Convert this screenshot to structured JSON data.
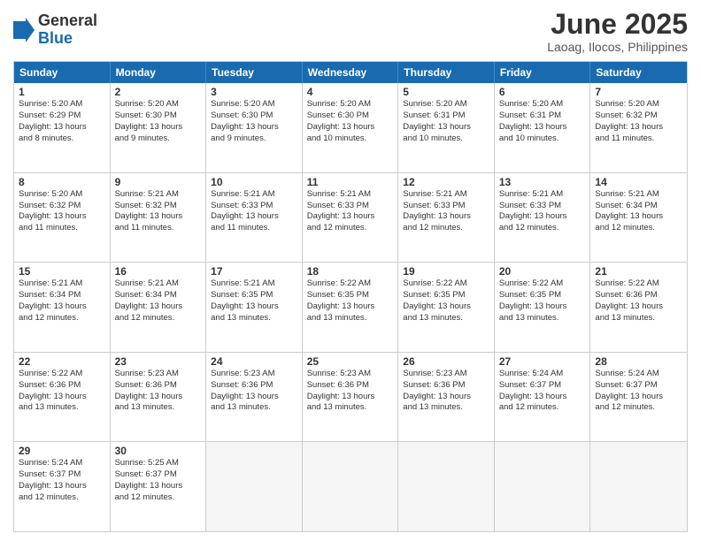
{
  "logo": {
    "general": "General",
    "blue": "Blue"
  },
  "title": "June 2025",
  "subtitle": "Laoag, Ilocos, Philippines",
  "headers": [
    "Sunday",
    "Monday",
    "Tuesday",
    "Wednesday",
    "Thursday",
    "Friday",
    "Saturday"
  ],
  "rows": [
    [
      {
        "day": "",
        "lines": [],
        "empty": true
      },
      {
        "day": "",
        "lines": [],
        "empty": true
      },
      {
        "day": "",
        "lines": [],
        "empty": true
      },
      {
        "day": "",
        "lines": [],
        "empty": true
      },
      {
        "day": "",
        "lines": [],
        "empty": true
      },
      {
        "day": "",
        "lines": [],
        "empty": true
      },
      {
        "day": "",
        "lines": [],
        "empty": true
      }
    ],
    [
      {
        "day": "1",
        "lines": [
          "Sunrise: 5:20 AM",
          "Sunset: 6:29 PM",
          "Daylight: 13 hours",
          "and 8 minutes."
        ],
        "empty": false
      },
      {
        "day": "2",
        "lines": [
          "Sunrise: 5:20 AM",
          "Sunset: 6:30 PM",
          "Daylight: 13 hours",
          "and 9 minutes."
        ],
        "empty": false
      },
      {
        "day": "3",
        "lines": [
          "Sunrise: 5:20 AM",
          "Sunset: 6:30 PM",
          "Daylight: 13 hours",
          "and 9 minutes."
        ],
        "empty": false
      },
      {
        "day": "4",
        "lines": [
          "Sunrise: 5:20 AM",
          "Sunset: 6:30 PM",
          "Daylight: 13 hours",
          "and 10 minutes."
        ],
        "empty": false
      },
      {
        "day": "5",
        "lines": [
          "Sunrise: 5:20 AM",
          "Sunset: 6:31 PM",
          "Daylight: 13 hours",
          "and 10 minutes."
        ],
        "empty": false
      },
      {
        "day": "6",
        "lines": [
          "Sunrise: 5:20 AM",
          "Sunset: 6:31 PM",
          "Daylight: 13 hours",
          "and 10 minutes."
        ],
        "empty": false
      },
      {
        "day": "7",
        "lines": [
          "Sunrise: 5:20 AM",
          "Sunset: 6:32 PM",
          "Daylight: 13 hours",
          "and 11 minutes."
        ],
        "empty": false
      }
    ],
    [
      {
        "day": "8",
        "lines": [
          "Sunrise: 5:20 AM",
          "Sunset: 6:32 PM",
          "Daylight: 13 hours",
          "and 11 minutes."
        ],
        "empty": false
      },
      {
        "day": "9",
        "lines": [
          "Sunrise: 5:21 AM",
          "Sunset: 6:32 PM",
          "Daylight: 13 hours",
          "and 11 minutes."
        ],
        "empty": false
      },
      {
        "day": "10",
        "lines": [
          "Sunrise: 5:21 AM",
          "Sunset: 6:33 PM",
          "Daylight: 13 hours",
          "and 11 minutes."
        ],
        "empty": false
      },
      {
        "day": "11",
        "lines": [
          "Sunrise: 5:21 AM",
          "Sunset: 6:33 PM",
          "Daylight: 13 hours",
          "and 12 minutes."
        ],
        "empty": false
      },
      {
        "day": "12",
        "lines": [
          "Sunrise: 5:21 AM",
          "Sunset: 6:33 PM",
          "Daylight: 13 hours",
          "and 12 minutes."
        ],
        "empty": false
      },
      {
        "day": "13",
        "lines": [
          "Sunrise: 5:21 AM",
          "Sunset: 6:33 PM",
          "Daylight: 13 hours",
          "and 12 minutes."
        ],
        "empty": false
      },
      {
        "day": "14",
        "lines": [
          "Sunrise: 5:21 AM",
          "Sunset: 6:34 PM",
          "Daylight: 13 hours",
          "and 12 minutes."
        ],
        "empty": false
      }
    ],
    [
      {
        "day": "15",
        "lines": [
          "Sunrise: 5:21 AM",
          "Sunset: 6:34 PM",
          "Daylight: 13 hours",
          "and 12 minutes."
        ],
        "empty": false
      },
      {
        "day": "16",
        "lines": [
          "Sunrise: 5:21 AM",
          "Sunset: 6:34 PM",
          "Daylight: 13 hours",
          "and 12 minutes."
        ],
        "empty": false
      },
      {
        "day": "17",
        "lines": [
          "Sunrise: 5:21 AM",
          "Sunset: 6:35 PM",
          "Daylight: 13 hours",
          "and 13 minutes."
        ],
        "empty": false
      },
      {
        "day": "18",
        "lines": [
          "Sunrise: 5:22 AM",
          "Sunset: 6:35 PM",
          "Daylight: 13 hours",
          "and 13 minutes."
        ],
        "empty": false
      },
      {
        "day": "19",
        "lines": [
          "Sunrise: 5:22 AM",
          "Sunset: 6:35 PM",
          "Daylight: 13 hours",
          "and 13 minutes."
        ],
        "empty": false
      },
      {
        "day": "20",
        "lines": [
          "Sunrise: 5:22 AM",
          "Sunset: 6:35 PM",
          "Daylight: 13 hours",
          "and 13 minutes."
        ],
        "empty": false
      },
      {
        "day": "21",
        "lines": [
          "Sunrise: 5:22 AM",
          "Sunset: 6:36 PM",
          "Daylight: 13 hours",
          "and 13 minutes."
        ],
        "empty": false
      }
    ],
    [
      {
        "day": "22",
        "lines": [
          "Sunrise: 5:22 AM",
          "Sunset: 6:36 PM",
          "Daylight: 13 hours",
          "and 13 minutes."
        ],
        "empty": false
      },
      {
        "day": "23",
        "lines": [
          "Sunrise: 5:23 AM",
          "Sunset: 6:36 PM",
          "Daylight: 13 hours",
          "and 13 minutes."
        ],
        "empty": false
      },
      {
        "day": "24",
        "lines": [
          "Sunrise: 5:23 AM",
          "Sunset: 6:36 PM",
          "Daylight: 13 hours",
          "and 13 minutes."
        ],
        "empty": false
      },
      {
        "day": "25",
        "lines": [
          "Sunrise: 5:23 AM",
          "Sunset: 6:36 PM",
          "Daylight: 13 hours",
          "and 13 minutes."
        ],
        "empty": false
      },
      {
        "day": "26",
        "lines": [
          "Sunrise: 5:23 AM",
          "Sunset: 6:36 PM",
          "Daylight: 13 hours",
          "and 13 minutes."
        ],
        "empty": false
      },
      {
        "day": "27",
        "lines": [
          "Sunrise: 5:24 AM",
          "Sunset: 6:37 PM",
          "Daylight: 13 hours",
          "and 12 minutes."
        ],
        "empty": false
      },
      {
        "day": "28",
        "lines": [
          "Sunrise: 5:24 AM",
          "Sunset: 6:37 PM",
          "Daylight: 13 hours",
          "and 12 minutes."
        ],
        "empty": false
      }
    ],
    [
      {
        "day": "29",
        "lines": [
          "Sunrise: 5:24 AM",
          "Sunset: 6:37 PM",
          "Daylight: 13 hours",
          "and 12 minutes."
        ],
        "empty": false
      },
      {
        "day": "30",
        "lines": [
          "Sunrise: 5:25 AM",
          "Sunset: 6:37 PM",
          "Daylight: 13 hours",
          "and 12 minutes."
        ],
        "empty": false
      },
      {
        "day": "",
        "lines": [],
        "empty": true
      },
      {
        "day": "",
        "lines": [],
        "empty": true
      },
      {
        "day": "",
        "lines": [],
        "empty": true
      },
      {
        "day": "",
        "lines": [],
        "empty": true
      },
      {
        "day": "",
        "lines": [],
        "empty": true
      }
    ]
  ]
}
